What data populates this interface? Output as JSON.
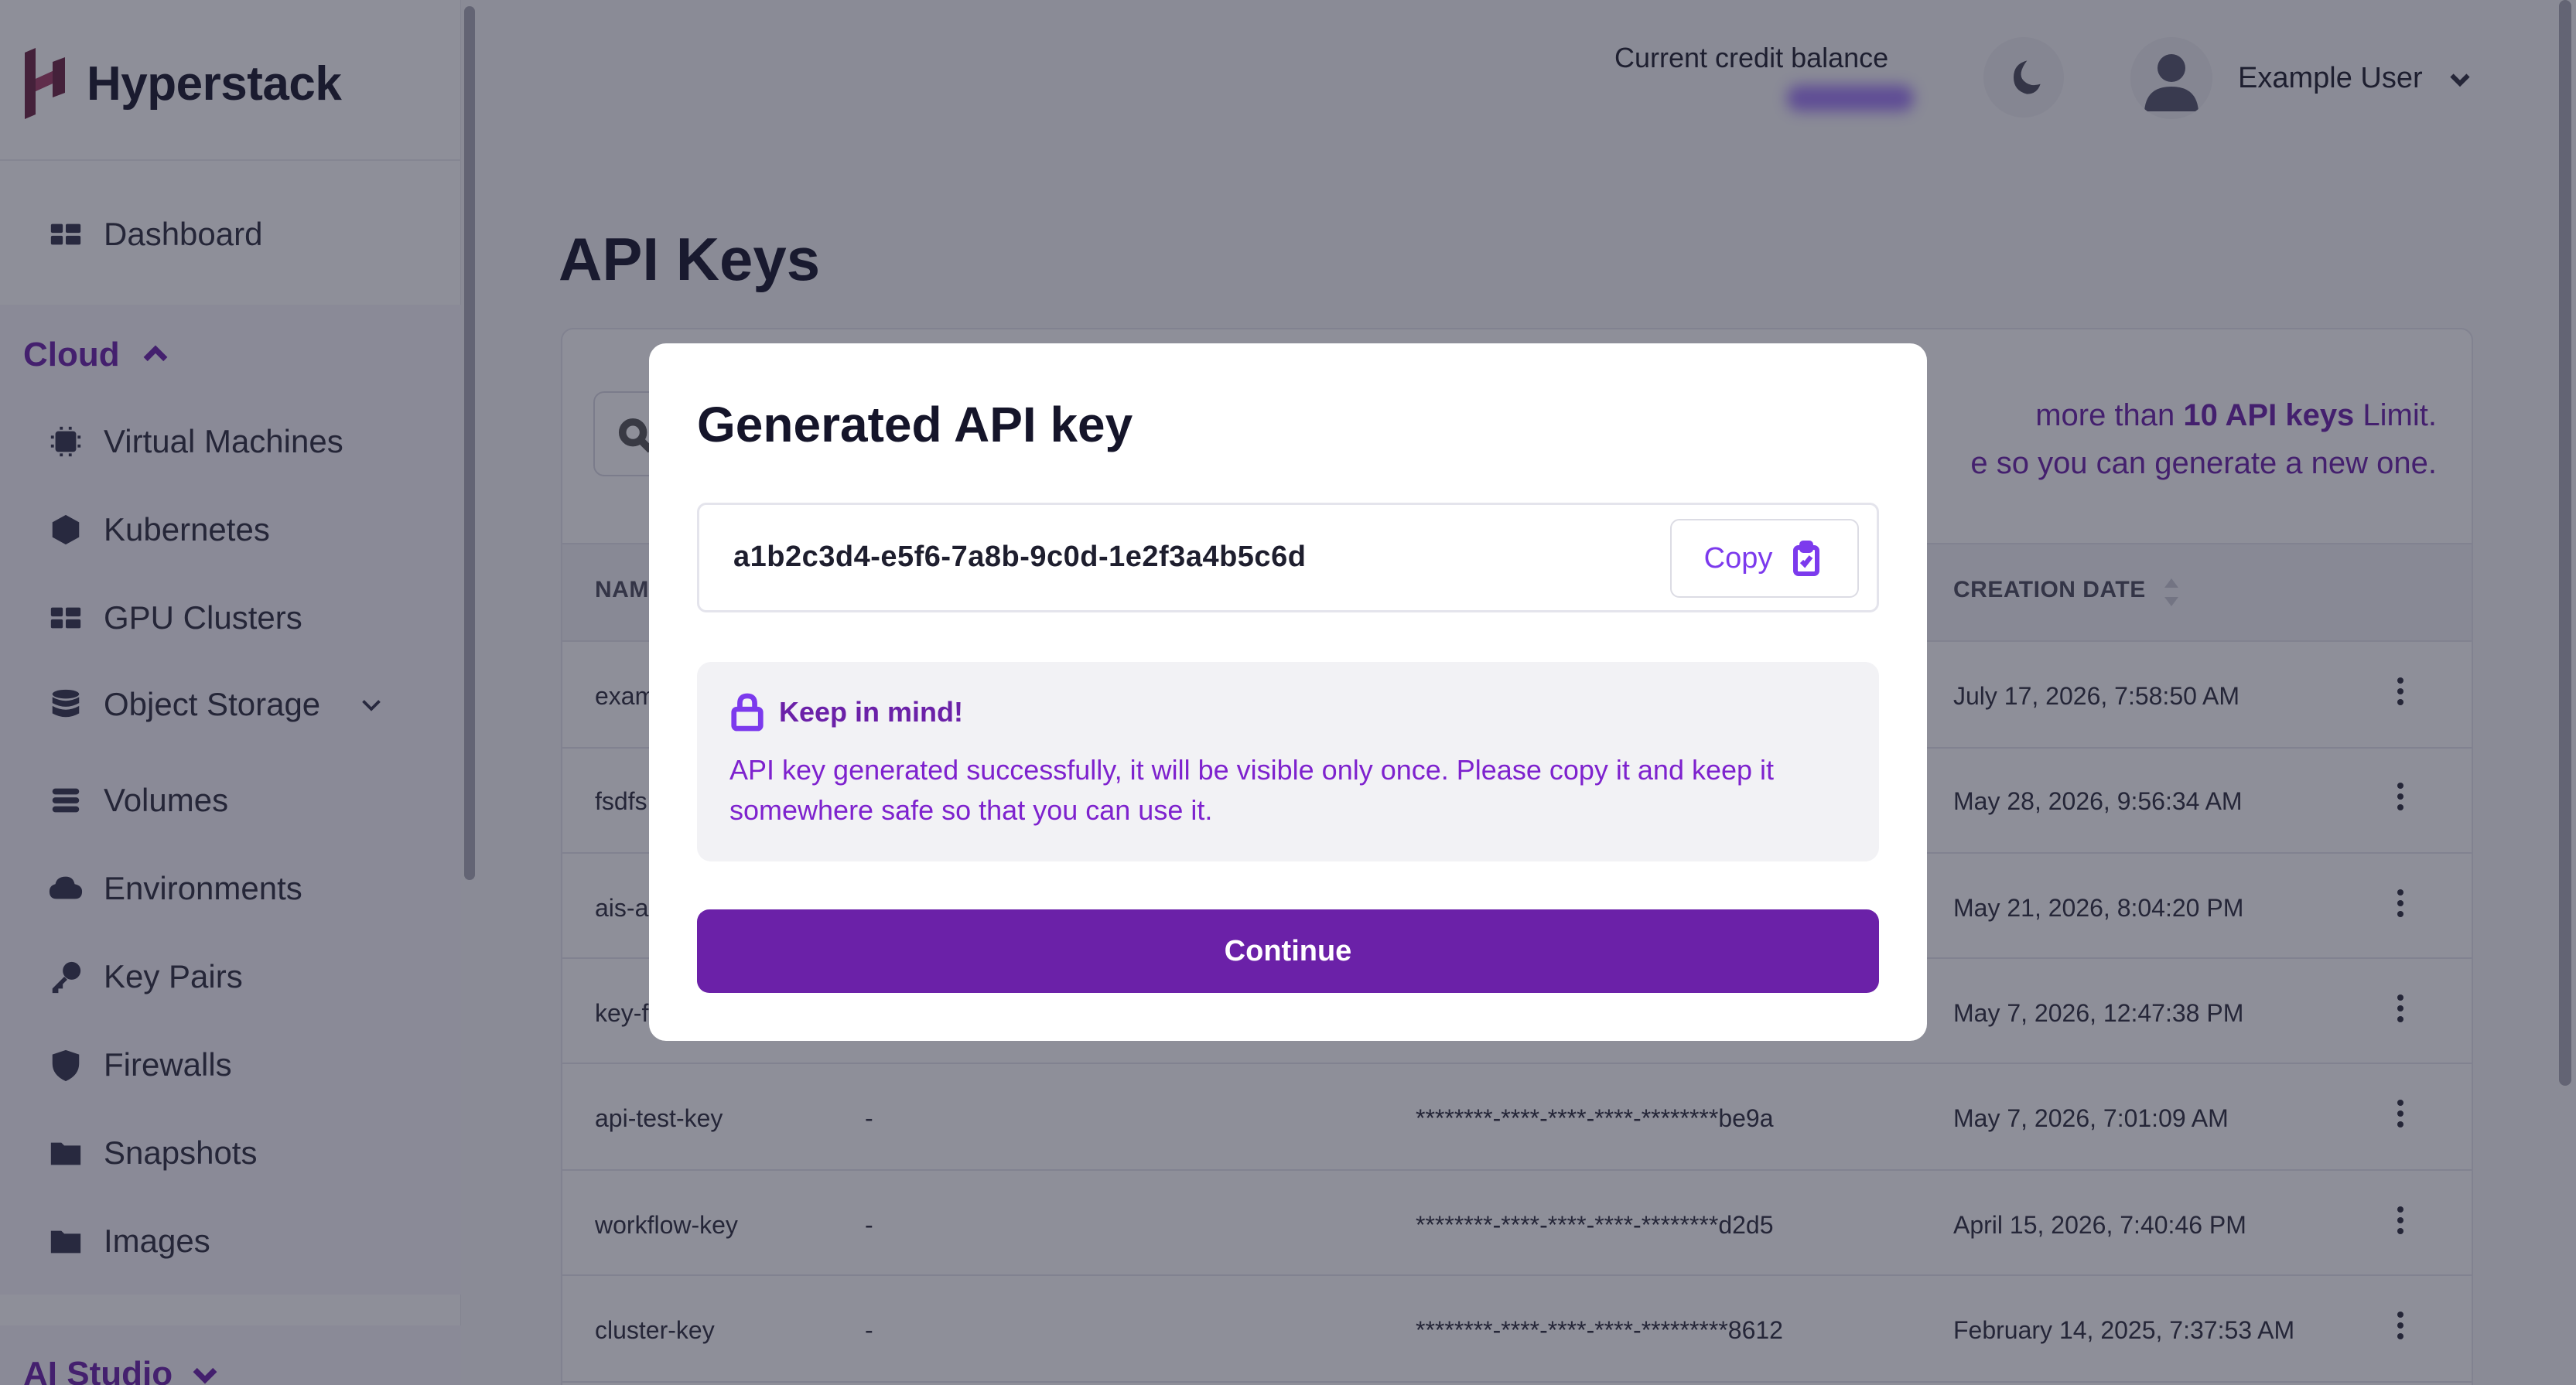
{
  "app": {
    "name": "Hyperstack"
  },
  "sidebar": {
    "dashboard_label": "Dashboard",
    "cloud_label": "Cloud",
    "items": [
      {
        "label": "Virtual Machines",
        "icon": "chip-icon"
      },
      {
        "label": "Kubernetes",
        "icon": "cube-icon"
      },
      {
        "label": "GPU Clusters",
        "icon": "grid-icon"
      },
      {
        "label": "Object Storage",
        "icon": "database-icon"
      },
      {
        "label": "Volumes",
        "icon": "volume-icon"
      },
      {
        "label": "Environments",
        "icon": "cloud-icon"
      },
      {
        "label": "Key Pairs",
        "icon": "key-icon"
      },
      {
        "label": "Firewalls",
        "icon": "shield-icon"
      },
      {
        "label": "Snapshots",
        "icon": "snapshot-icon"
      },
      {
        "label": "Images",
        "icon": "image-icon"
      }
    ],
    "ai_studio_label": "AI Studio"
  },
  "header": {
    "credit_label": "Current credit balance",
    "user_name": "Example User"
  },
  "page": {
    "title": "API Keys",
    "limit_line1_prefix": "more than ",
    "limit_line1_bold": "10 API keys",
    "limit_line1_suffix": " Limit.",
    "limit_line2": "e so you can generate a new one."
  },
  "table": {
    "columns": {
      "name": "NAM",
      "creation_date": "CREATION DATE"
    },
    "rows": [
      {
        "name": "exam",
        "description": "",
        "key": "",
        "date": "July 17, 2026, 7:58:50 AM"
      },
      {
        "name": "fsdfs",
        "description": "",
        "key": "",
        "date": "May 28, 2026, 9:56:34 AM"
      },
      {
        "name": "ais-a",
        "description": "",
        "key": "",
        "date": "May 21, 2026, 8:04:20 PM"
      },
      {
        "name": "key-f",
        "description": "",
        "key": "",
        "date": "May 7, 2026, 12:47:38 PM"
      },
      {
        "name": "api-test-key",
        "description": "-",
        "key": "********-****-****-****-********be9a",
        "date": "May 7, 2026, 7:01:09 AM"
      },
      {
        "name": "workflow-key",
        "description": "-",
        "key": "********-****-****-****-********d2d5",
        "date": "April 15, 2026, 7:40:46 PM"
      },
      {
        "name": "cluster-key",
        "description": "-",
        "key": "********-****-****-****-*********8612",
        "date": "February 14, 2025, 7:37:53 AM"
      }
    ]
  },
  "modal": {
    "title": "Generated API key",
    "api_key": "a1b2c3d4-e5f6-7a8b-9c0d-1e2f3a4b5c6d",
    "copy_label": "Copy",
    "keep_title": "Keep in mind!",
    "keep_text": "API key generated successfully, it will be visible only once. Please copy it and keep it somewhere safe so that you can use it.",
    "continue_label": "Continue"
  },
  "colors": {
    "accent": "#6b21a8",
    "accent_text": "#7e22ce",
    "overlay": "rgba(30,32,52,0.5)"
  }
}
